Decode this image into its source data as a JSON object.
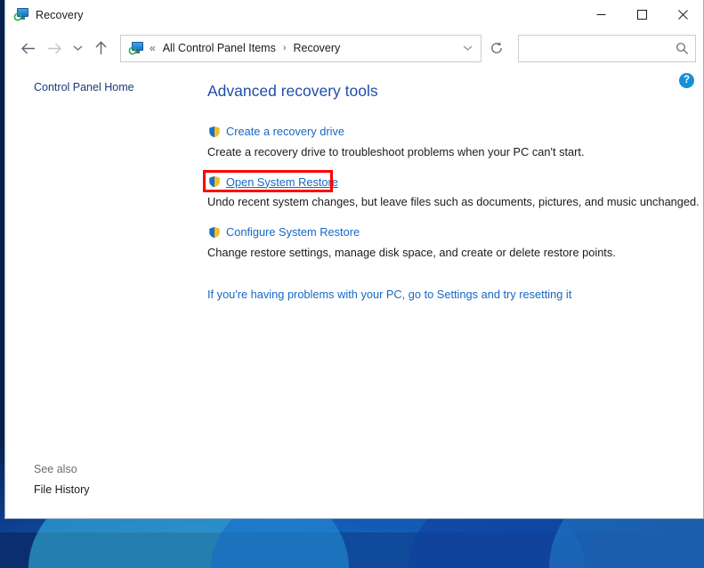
{
  "window": {
    "title": "Recovery",
    "icon": "recovery-icon",
    "caption_buttons": [
      {
        "name": "minimize",
        "glyph": "minimize-icon"
      },
      {
        "name": "maximize",
        "glyph": "maximize-icon"
      },
      {
        "name": "close",
        "glyph": "close-icon"
      }
    ]
  },
  "navbar": {
    "back_tooltip": "Back",
    "forward_tooltip": "Forward",
    "recent_tooltip": "Recent locations",
    "up_tooltip": "Up",
    "address": {
      "icon": "recovery-icon",
      "overflow": "«",
      "crumbs": [
        "All Control Panel Items",
        "Recovery"
      ],
      "separator": "›",
      "dropdown": "⌄",
      "refresh": "refresh-icon"
    },
    "search": {
      "value": "",
      "placeholder": "",
      "icon": "search-icon"
    }
  },
  "sidebar": {
    "home_link": "Control Panel Home",
    "see_also_label": "See also",
    "see_also_links": [
      "File History"
    ]
  },
  "main": {
    "heading": "Advanced recovery tools",
    "help_button": "?",
    "tasks": [
      {
        "icon": "shield-icon",
        "link": "Create a recovery drive",
        "description": "Create a recovery drive to troubleshoot problems when your PC can't start.",
        "highlighted": false
      },
      {
        "icon": "shield-icon",
        "link": "Open System Restore",
        "description": "Undo recent system changes, but leave files such as documents, pictures, and music unchanged.",
        "highlighted": true
      },
      {
        "icon": "shield-icon",
        "link": "Configure System Restore",
        "description": "Change restore settings, manage disk space, and create or delete restore points.",
        "highlighted": false
      }
    ],
    "footer_link": "If you're having problems with your PC, go to Settings and try resetting it"
  },
  "colors": {
    "link": "#1668c4",
    "heading": "#1f4daa",
    "highlight": "#fe0000",
    "help_badge": "#1490d8",
    "window_border": "#9bb0c4"
  }
}
